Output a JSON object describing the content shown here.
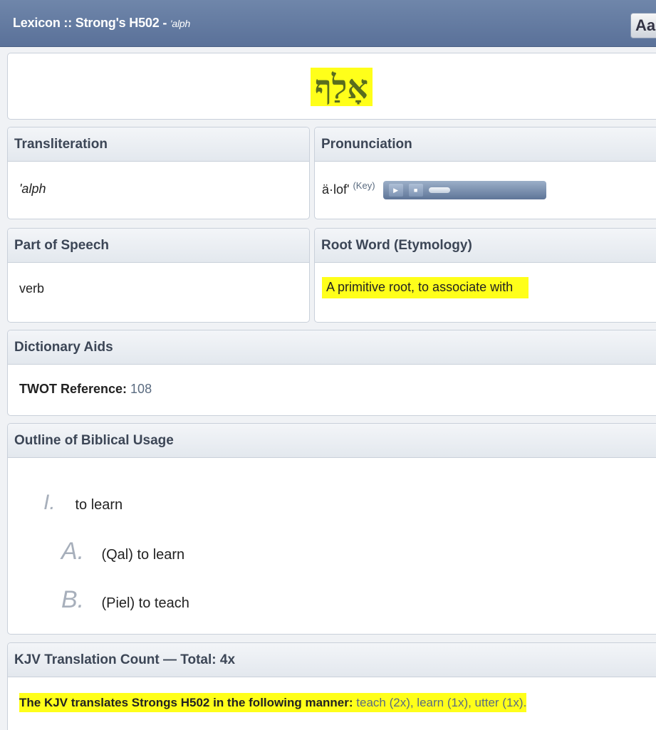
{
  "header": {
    "title_prefix": "Lexicon :: Strong's H502 - ",
    "title_translit": "'alph",
    "font_button": "Aa"
  },
  "word": {
    "hebrew": "אָלַף"
  },
  "transliteration": {
    "label": "Transliteration",
    "value": "'alph"
  },
  "pronunciation": {
    "label": "Pronunciation",
    "value": "ä·lof'",
    "key_label": "(Key)"
  },
  "part_of_speech": {
    "label": "Part of Speech",
    "value": "verb"
  },
  "root_word": {
    "label": "Root Word (Etymology)",
    "value": "A primitive root, to associate with"
  },
  "dictionary_aids": {
    "label": "Dictionary Aids",
    "twot_label": "TWOT Reference:",
    "twot_value": "108"
  },
  "outline": {
    "label": "Outline of Biblical Usage",
    "items": [
      {
        "num": "I.",
        "text": "to learn"
      },
      {
        "num": "A.",
        "text": "(Qal) to learn"
      },
      {
        "num": "B.",
        "text": "(Piel) to teach"
      }
    ]
  },
  "kjv": {
    "label": "KJV Translation Count — Total: 4x",
    "intro": "The KJV translates Strongs H502 in the following manner:",
    "entries": "teach (2x), learn (1x), utter (1x)."
  },
  "colors": {
    "highlight": "#ffff1a",
    "header_bg": "#5a7199",
    "hebrew": "#5a6e1e"
  }
}
